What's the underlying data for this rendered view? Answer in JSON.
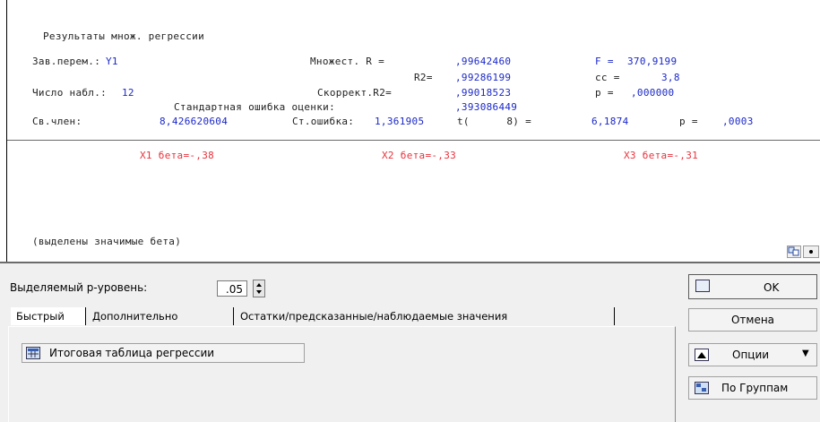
{
  "results": {
    "title": "Результаты множ. регрессии",
    "dep_var_label": "Зав.перем.:",
    "dep_var_value": "Y1",
    "n_obs_label": "Число набл.:",
    "n_obs_value": "12",
    "multiple_r_label": "Множест. R =",
    "multiple_r_value": ",99642460",
    "r2_label": "R2=",
    "r2_value": ",99286199",
    "adj_r2_label": "Скоррект.R2=",
    "adj_r2_value": ",99018523",
    "f_label": "F =",
    "f_value": "370,9199",
    "df_label": "cc =",
    "df_value": "3,8",
    "p_label": "p =",
    "p_value": ",000000",
    "std_err_est_label": "Стандартная ошибка оценки:",
    "std_err_est_value": ",393086449",
    "intercept_label": "Св.член:",
    "intercept_value": "8,426620604",
    "intercept_se_label": "Ст.ошибка:",
    "intercept_se_value": "1,361905",
    "t_label": "t(      8) =",
    "t_value": "6,1874",
    "intercept_p_label": "p =",
    "intercept_p_value": ",0003",
    "beta_x1": "X1 бета=-,38",
    "beta_x2": "X2 бета=-,33",
    "beta_x3": "X3 бета=-,31",
    "footer_note": "(выделены значимые бета)"
  },
  "dialog": {
    "p_level_label": "Выделяемый р-уровень:",
    "p_level_value": ".05",
    "tabs": [
      {
        "label": "Быстрый"
      },
      {
        "label": "Дополнительно"
      },
      {
        "label": "Остатки/предсказанные/наблюдаемые значения"
      }
    ],
    "summary_button": "Итоговая таблица регрессии",
    "ok_button": "OK",
    "cancel_button": "Отмена",
    "options_button": "Опции",
    "groups_button": "По Группам"
  },
  "colors": {
    "value_blue": "#1a27c8",
    "significant_red": "#e8323c"
  }
}
